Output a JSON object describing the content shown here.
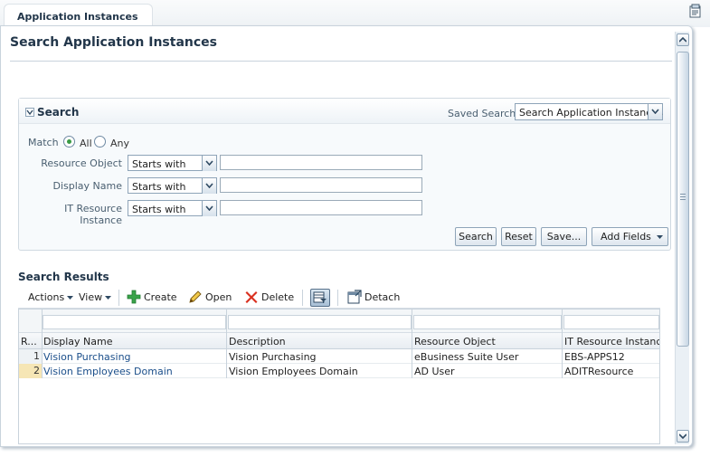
{
  "tab": {
    "label": "Application Instances"
  },
  "page": {
    "title": "Search Application Instances"
  },
  "search": {
    "title": "Search",
    "saved_search_label": "Saved Search",
    "saved_search_value": "Search Application Instances",
    "match_label": "Match",
    "match_options": [
      "All",
      "Any"
    ],
    "match_selected": "All",
    "fields": [
      {
        "label": "Resource Object",
        "operator": "Starts with",
        "value": ""
      },
      {
        "label": "Display Name",
        "operator": "Starts with",
        "value": ""
      },
      {
        "label": "IT Resource Instance",
        "operator": "Starts with",
        "value": ""
      }
    ],
    "buttons": {
      "search": "Search",
      "reset": "Reset",
      "save": "Save...",
      "add_fields": "Add Fields"
    }
  },
  "results": {
    "title": "Search Results",
    "toolbar": {
      "actions": "Actions",
      "view": "View",
      "create": "Create",
      "open": "Open",
      "delete": "Delete",
      "detach": "Detach"
    },
    "columns": [
      "R...",
      "Display Name",
      "Description",
      "Resource Object",
      "IT Resource Instance"
    ],
    "rows": [
      {
        "num": "1",
        "display_name": "Vision Purchasing",
        "description": "Vision Purchasing",
        "resource_object": "eBusiness Suite User",
        "it_resource": "EBS-APPS12"
      },
      {
        "num": "2",
        "display_name": "Vision Employees Domain",
        "description": "Vision Employees Domain",
        "resource_object": "AD User",
        "it_resource": "ADITResource"
      }
    ]
  },
  "colors": {
    "title": "#22364a",
    "link": "#1a4e8a",
    "selected_row": "#f6e6b5",
    "border": "#c9d3dc"
  }
}
